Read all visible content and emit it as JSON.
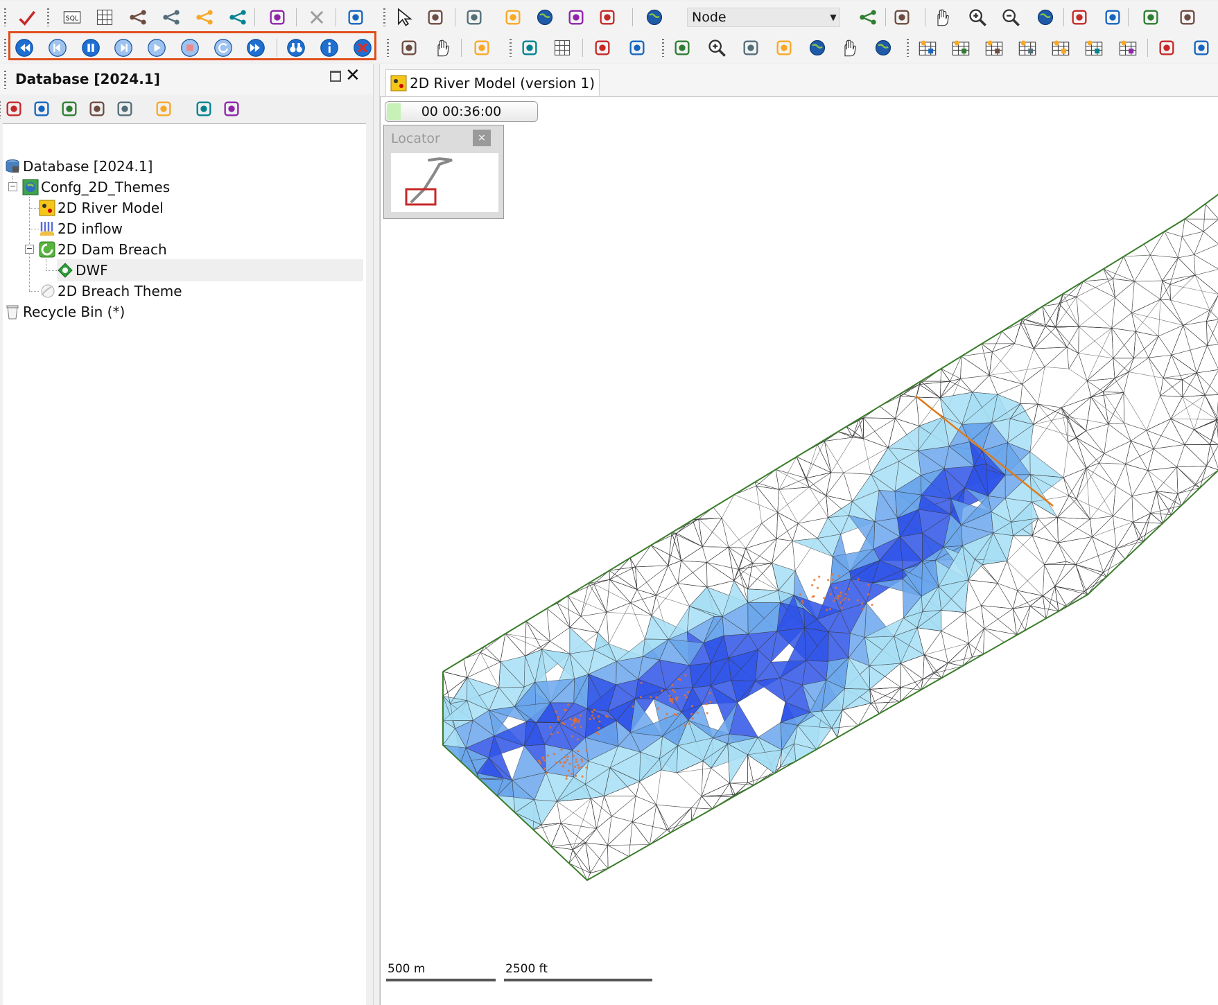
{
  "toolbar1": {
    "layer_select_value": "Node",
    "icons": [
      "validate-check-icon",
      "sql-icon",
      "grid-icon",
      "network-red-icon",
      "network-green-icon",
      "network-red2-icon",
      "network-gray-icon",
      "binoculars-icon",
      "delete-x-icon",
      "select-delete-icon",
      "pointer-icon",
      "select-polygon-icon",
      "trace-red-icon",
      "node-tool-icon",
      "globe-tool-icon",
      "text-tool-icon",
      "ruler-icon",
      "layer-globe-icon",
      "find-network-icon",
      "pipe-tool-icon",
      "pan-hand-icon",
      "zoom-in-icon",
      "zoom-out-icon",
      "info-globe-icon",
      "mountain-icon",
      "search-tool-icon",
      "trace-icon",
      "split-icon"
    ]
  },
  "toolbar2": {
    "playback_icons": [
      "rewind-start-icon",
      "step-back-icon",
      "pause-icon",
      "step-forward-icon",
      "play-icon",
      "stop-icon",
      "refresh-icon",
      "fast-forward-icon",
      "binoculars-icon",
      "info-icon",
      "close-results-icon"
    ],
    "icons": [
      "zoom-window-icon",
      "pan-icon",
      "layers-icon",
      "frame-icon",
      "table-icon",
      "window-icon",
      "window2-icon",
      "move-icon",
      "zoom-in-icon",
      "center-icon",
      "zoom-extent-icon",
      "globe2-icon",
      "hand-icon",
      "earth-icon",
      "theme1-icon",
      "theme2-icon",
      "theme3-icon",
      "theme4-icon",
      "theme5-icon",
      "theme6-icon",
      "theme7-icon",
      "export-icon",
      "import-icon"
    ]
  },
  "panel": {
    "title": "Database [2024.1]",
    "tree": [
      {
        "label": "Database [2024.1]",
        "icon": "database-icon"
      },
      {
        "label": "Confg_2D_Themes",
        "icon": "model-group-icon"
      },
      {
        "label": "2D River Model",
        "icon": "network-model-icon"
      },
      {
        "label": "2D inflow",
        "icon": "inflow-icon"
      },
      {
        "label": "2D Dam Breach",
        "icon": "run-group-icon"
      },
      {
        "label": "DWF",
        "icon": "dwf-icon"
      },
      {
        "label": "2D Breach Theme",
        "icon": "theme-icon"
      },
      {
        "label": "Recycle Bin (*)",
        "icon": "recycle-bin-icon"
      }
    ]
  },
  "document": {
    "tab_title": "2D River Model (version 1)",
    "sim_time": "00 00:36:00",
    "locator_title": "Locator",
    "locator_close": "×",
    "scale_metric": "500 m",
    "scale_imperial": "2500 ft"
  },
  "colors": {
    "highlight_border": "#e04e1a",
    "mesh_boundary": "#3a7d2a",
    "flood_light": "#a6def5",
    "flood_mid": "#6aa6ec",
    "flood_deep": "#2f53e8",
    "breach_line": "#e07a1a"
  }
}
